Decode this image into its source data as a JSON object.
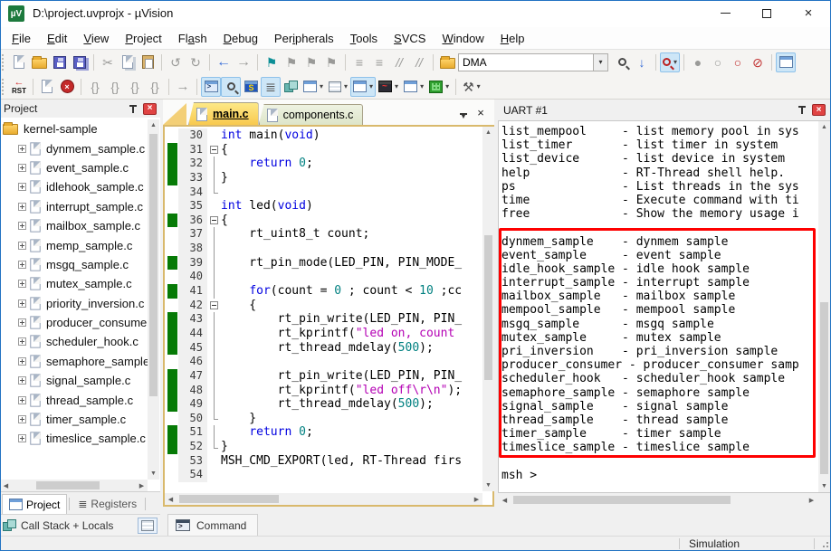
{
  "window": {
    "title": "D:\\project.uvprojx - µVision"
  },
  "menu": {
    "items": [
      {
        "label": "File",
        "u": 0
      },
      {
        "label": "Edit",
        "u": 0
      },
      {
        "label": "View",
        "u": 0
      },
      {
        "label": "Project",
        "u": 0
      },
      {
        "label": "Flash",
        "u": 2
      },
      {
        "label": "Debug",
        "u": 0
      },
      {
        "label": "Peripherals",
        "u": 3
      },
      {
        "label": "Tools",
        "u": 0
      },
      {
        "label": "SVCS",
        "u": 0
      },
      {
        "label": "Window",
        "u": 0
      },
      {
        "label": "Help",
        "u": 0
      }
    ]
  },
  "toolbar": {
    "find_value": "DMA",
    "rst_label": "RST"
  },
  "icons": {
    "scissors": "✂",
    "undo": "↺",
    "redo": "↻",
    "back": "←",
    "forward": "→",
    "flag": "⚑",
    "lines": "≡",
    "comment": "//",
    "bp_dot": "●",
    "bp_circle": "○",
    "bp_kill": "⊘",
    "down_arrow": "↓",
    "braces": "{}",
    "run_arrow": "➔",
    "caret": "▾",
    "reg_lines": "≣",
    "symbol_s": "S",
    "tools": "⚒",
    "close_x": "×",
    "min": "–",
    "up": "▲",
    "down": "▼",
    "left": "◀",
    "right": "▶"
  },
  "project_panel": {
    "title": "Project",
    "root_label": "kernel-sample",
    "files": [
      "dynmem_sample.c",
      "event_sample.c",
      "idlehook_sample.c",
      "interrupt_sample.c",
      "mailbox_sample.c",
      "memp_sample.c",
      "msgq_sample.c",
      "mutex_sample.c",
      "priority_inversion.c",
      "producer_consumer",
      "scheduler_hook.c",
      "semaphore_sample.",
      "signal_sample.c",
      "thread_sample.c",
      "timer_sample.c",
      "timeslice_sample.c"
    ],
    "bottom_tabs": [
      {
        "label": "Project",
        "active": true
      },
      {
        "label": "Registers",
        "active": false
      }
    ]
  },
  "callstack_bar": {
    "label": "Call Stack + Locals"
  },
  "command_bar": {
    "label": "Command"
  },
  "editor": {
    "tabs": [
      {
        "label": "main.c",
        "active": true
      },
      {
        "label": "components.c",
        "active": false
      }
    ],
    "lines": [
      {
        "n": 30,
        "g": false,
        "f": "",
        "s": [
          [
            "int",
            "k"
          ],
          [
            " main(",
            "p"
          ],
          [
            "void",
            "k"
          ],
          [
            ")",
            "p"
          ]
        ]
      },
      {
        "n": 31,
        "g": true,
        "f": "m",
        "s": [
          [
            "{",
            "p"
          ]
        ]
      },
      {
        "n": 32,
        "g": true,
        "f": "l",
        "s": [
          [
            "    ",
            "p"
          ],
          [
            "return",
            "k"
          ],
          [
            " ",
            "p"
          ],
          [
            "0",
            "n"
          ],
          [
            ";",
            "p"
          ]
        ]
      },
      {
        "n": 33,
        "g": true,
        "f": "l",
        "s": [
          [
            "}",
            "p"
          ]
        ]
      },
      {
        "n": 34,
        "g": false,
        "f": "e",
        "s": []
      },
      {
        "n": 35,
        "g": false,
        "f": "",
        "s": [
          [
            "int",
            "k"
          ],
          [
            " led(",
            "p"
          ],
          [
            "void",
            "k"
          ],
          [
            ")",
            "p"
          ]
        ]
      },
      {
        "n": 36,
        "g": true,
        "f": "m",
        "s": [
          [
            "{",
            "p"
          ]
        ]
      },
      {
        "n": 37,
        "g": false,
        "f": "l",
        "s": [
          [
            "    rt_uint8_t count;",
            "p"
          ]
        ]
      },
      {
        "n": 38,
        "g": false,
        "f": "l",
        "s": []
      },
      {
        "n": 39,
        "g": true,
        "f": "l",
        "s": [
          [
            "    rt_pin_mode(LED_PIN, PIN_MODE_",
            "p"
          ]
        ]
      },
      {
        "n": 40,
        "g": false,
        "f": "l",
        "s": []
      },
      {
        "n": 41,
        "g": true,
        "f": "l",
        "s": [
          [
            "    ",
            "p"
          ],
          [
            "for",
            "k"
          ],
          [
            "(count = ",
            "p"
          ],
          [
            "0",
            "n"
          ],
          [
            " ; count < ",
            "p"
          ],
          [
            "10",
            "n"
          ],
          [
            " ;cc",
            "p"
          ]
        ]
      },
      {
        "n": 42,
        "g": false,
        "f": "m",
        "s": [
          [
            "    {",
            "p"
          ]
        ]
      },
      {
        "n": 43,
        "g": true,
        "f": "l",
        "s": [
          [
            "        rt_pin_write(LED_PIN, PIN_",
            "p"
          ]
        ]
      },
      {
        "n": 44,
        "g": true,
        "f": "l",
        "s": [
          [
            "        rt_kprintf(",
            "p"
          ],
          [
            "\"led on, count",
            "s"
          ]
        ]
      },
      {
        "n": 45,
        "g": true,
        "f": "l",
        "s": [
          [
            "        rt_thread_mdelay(",
            "p"
          ],
          [
            "500",
            "n"
          ],
          [
            ");",
            "p"
          ]
        ]
      },
      {
        "n": 46,
        "g": false,
        "f": "l",
        "s": []
      },
      {
        "n": 47,
        "g": true,
        "f": "l",
        "s": [
          [
            "        rt_pin_write(LED_PIN, PIN_",
            "p"
          ]
        ]
      },
      {
        "n": 48,
        "g": true,
        "f": "l",
        "s": [
          [
            "        rt_kprintf(",
            "p"
          ],
          [
            "\"led off\\r\\n\"",
            "s"
          ],
          [
            ");",
            "p"
          ]
        ]
      },
      {
        "n": 49,
        "g": true,
        "f": "l",
        "s": [
          [
            "        rt_thread_mdelay(",
            "p"
          ],
          [
            "500",
            "n"
          ],
          [
            ");",
            "p"
          ]
        ]
      },
      {
        "n": 50,
        "g": false,
        "f": "e",
        "s": [
          [
            "    }",
            "p"
          ]
        ]
      },
      {
        "n": 51,
        "g": true,
        "f": "l",
        "s": [
          [
            "    ",
            "p"
          ],
          [
            "return",
            "k"
          ],
          [
            " ",
            "p"
          ],
          [
            "0",
            "n"
          ],
          [
            ";",
            "p"
          ]
        ]
      },
      {
        "n": 52,
        "g": true,
        "f": "e",
        "s": [
          [
            "}",
            "p"
          ]
        ]
      },
      {
        "n": 53,
        "g": false,
        "f": "",
        "s": [
          [
            "MSH_CMD_EXPORT(led, RT-Thread firs",
            "p"
          ]
        ]
      },
      {
        "n": 54,
        "g": false,
        "f": "",
        "s": []
      }
    ]
  },
  "uart": {
    "title": "UART #1",
    "lines": [
      "list_mempool     - list memory pool in sys",
      "list_timer       - list timer in system",
      "list_device      - list device in system",
      "help             - RT-Thread shell help.",
      "ps               - List threads in the sys",
      "time             - Execute command with ti",
      "free             - Show the memory usage i",
      "",
      "dynmem_sample    - dynmem sample",
      "event_sample     - event sample",
      "idle_hook_sample - idle hook sample",
      "interrupt_sample - interrupt sample",
      "mailbox_sample   - mailbox sample",
      "mempool_sample   - mempool sample",
      "msgq_sample      - msgq sample",
      "mutex_sample     - mutex sample",
      "pri_inversion    - pri_inversion sample",
      "producer_consumer - producer_consumer samp",
      "scheduler_hook   - scheduler_hook sample",
      "semaphore_sample - semaphore sample",
      "signal_sample    - signal sample",
      "thread_sample    - thread sample",
      "timer_sample     - timer sample",
      "timeslice_sample - timeslice sample",
      "",
      "msh >"
    ],
    "highlight_from_line": 8,
    "highlight_to_line": 23
  },
  "status_bar": {
    "mode": "Simulation"
  },
  "colors": {
    "accent_tab": "#f8c94e",
    "coverage_green": "#067a06",
    "highlight_red": "#fe0000",
    "keyword": "#0000e0",
    "number": "#008080",
    "string": "#b400b4",
    "close_button": "#e04343"
  }
}
